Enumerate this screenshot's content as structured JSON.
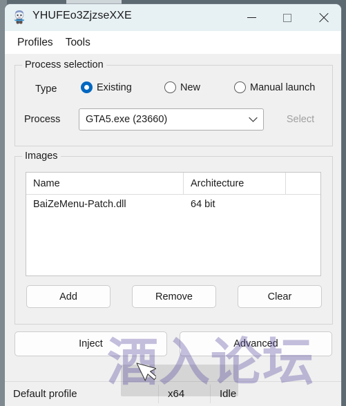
{
  "window": {
    "title": "YHUFEo3ZjzseXXE",
    "icon": "app-mascot-icon",
    "minimize_label": "Minimize",
    "maximize_label": "Maximize",
    "close_label": "Close"
  },
  "menubar": {
    "items": [
      {
        "label": "Profiles"
      },
      {
        "label": "Tools"
      }
    ]
  },
  "process_selection": {
    "legend": "Process selection",
    "type_label": "Type",
    "radios": [
      {
        "label": "Existing",
        "checked": true
      },
      {
        "label": "New",
        "checked": false
      },
      {
        "label": "Manual launch",
        "checked": false
      }
    ],
    "process_label": "Process",
    "process_value": "GTA5.exe (23660)",
    "select_button": "Select",
    "select_disabled": true
  },
  "images": {
    "legend": "Images",
    "columns": [
      "Name",
      "Architecture",
      ""
    ],
    "rows": [
      {
        "name": "BaiZeMenu-Patch.dll",
        "architecture": "64 bit"
      }
    ],
    "buttons": [
      {
        "label": "Add"
      },
      {
        "label": "Remove"
      },
      {
        "label": "Clear"
      }
    ]
  },
  "actions": {
    "inject_label": "Inject",
    "advanced_label": "Advanced"
  },
  "statusbar": {
    "profile": "Default profile",
    "architecture": "x64",
    "state": "Idle"
  },
  "watermark": {
    "text": "酒入论坛"
  },
  "colors": {
    "accent": "#0067c0",
    "titlebar": "#e7f0f3",
    "client": "#f0f0f0",
    "watermark": "#5c4ea0"
  }
}
